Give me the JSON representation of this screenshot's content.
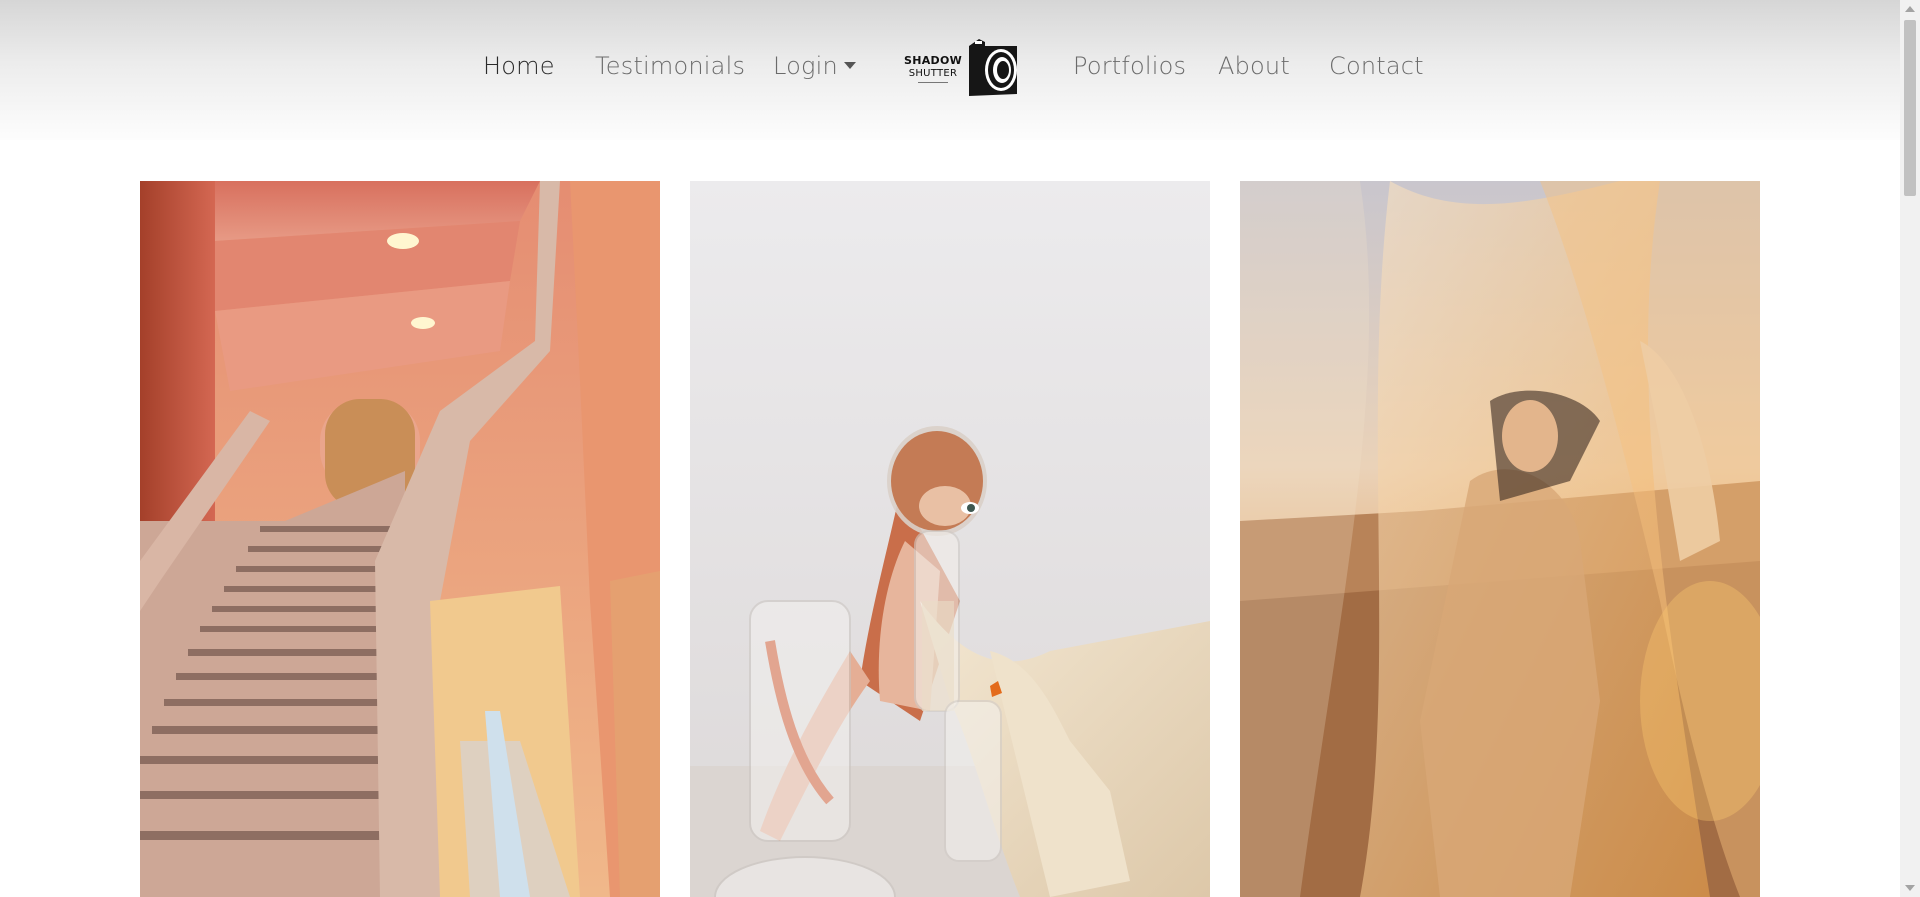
{
  "nav": {
    "left": [
      {
        "label": "Home",
        "active": true
      },
      {
        "label": "Testimonials"
      },
      {
        "label": "Login",
        "dropdown": true
      }
    ],
    "right": [
      {
        "label": "Portfolios"
      },
      {
        "label": "About"
      },
      {
        "label": "Contact"
      }
    ]
  },
  "logo": {
    "line1": "SHADOW",
    "line2": "SHUTTER",
    "icon": "camera-icon"
  },
  "gallery": [
    {
      "subject": "pink-staircase-photo"
    },
    {
      "subject": "woman-with-fishbowl-photo"
    },
    {
      "subject": "veiled-woman-desert-photo"
    }
  ],
  "colors": {
    "active_link": "#2b2b2b",
    "link": "#6b6b6b"
  }
}
